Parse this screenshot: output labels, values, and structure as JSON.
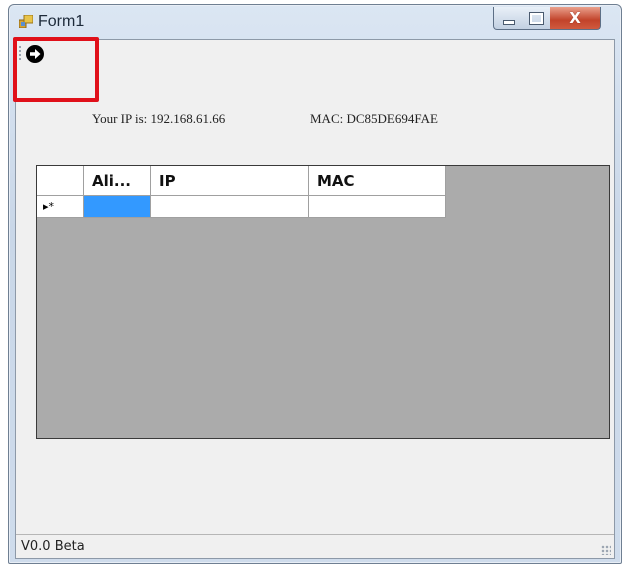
{
  "window": {
    "title": "Form1",
    "close_glyph": "X"
  },
  "toolbar": {
    "go_button_icon": "arrow-right-circle-icon"
  },
  "info": {
    "ip_label": "Your IP is:   192.168.61.66",
    "mac_label": "MAC: DC85DE694FAE"
  },
  "grid": {
    "columns": [
      "Ali...",
      "IP",
      "MAC"
    ],
    "row_indicator": "▸*",
    "rows": [
      {
        "alias": "",
        "ip": "",
        "mac": ""
      }
    ]
  },
  "status": {
    "text": "V0.0 Beta"
  },
  "colors": {
    "highlight_box": "#e0101a",
    "selected_cell": "#3399ff",
    "grid_background": "#ababab"
  }
}
